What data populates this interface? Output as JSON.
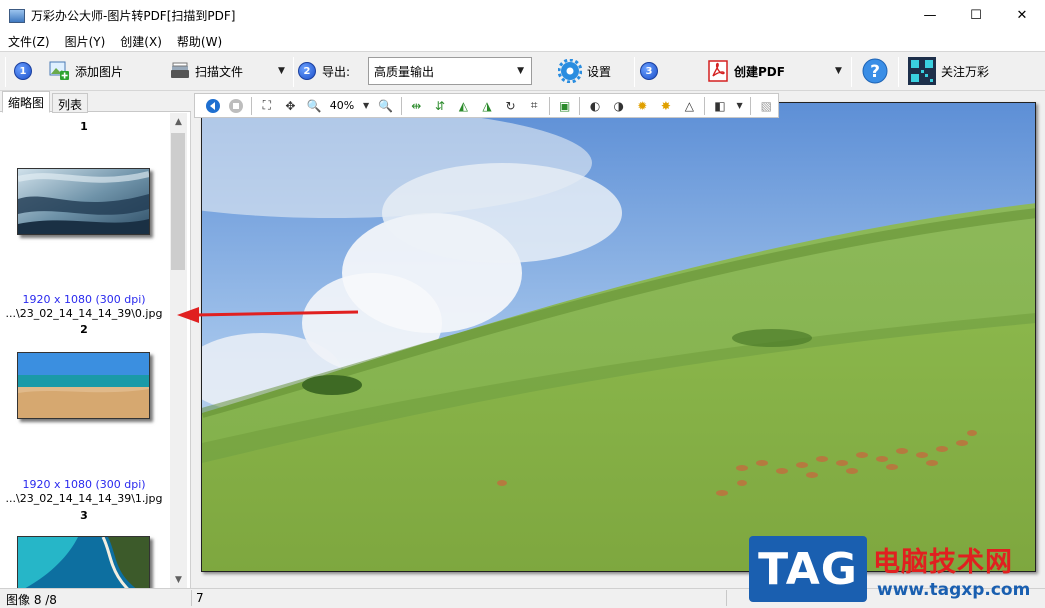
{
  "window": {
    "title": "万彩办公大师-图片转PDF[扫描到PDF]",
    "minimize": "—",
    "maximize": "☐",
    "close": "✕"
  },
  "menu": [
    "文件(Z)",
    "图片(Y)",
    "创建(X)",
    "帮助(W)"
  ],
  "toolbar": {
    "step1": "1",
    "add_images": "添加图片",
    "scan_file": "扫描文件",
    "step2": "2",
    "export_label": "导出:",
    "export_value": "高质量输出",
    "settings": "设置",
    "step3": "3",
    "create_pdf": "创建PDF",
    "follow": "关注万彩"
  },
  "left_panel": {
    "tabs": [
      "缩略图",
      "列表"
    ],
    "thumbnails": [
      {
        "number": "1",
        "resolution": "1920 x 1080 (300 dpi)",
        "path": "...\\23_02_14_14_14_39\\0.jpg"
      },
      {
        "number": "2",
        "resolution": "1920 x 1080 (300 dpi)",
        "path": "...\\23_02_14_14_14_39\\1.jpg"
      },
      {
        "number": "3",
        "resolution": "",
        "path": ""
      }
    ]
  },
  "viewer_toolbar": {
    "zoom": "40%"
  },
  "status": {
    "image_count": "图像 8 /8",
    "index": "7"
  },
  "watermark": {
    "logo": "TAG",
    "site_name": "电脑技术网",
    "url": "www.tagxp.com"
  },
  "colors": {
    "info_blue": "#2a2aee",
    "tag_blue": "#1a5fb0",
    "tag_red": "#e02020",
    "arrow_red": "#e02020"
  }
}
